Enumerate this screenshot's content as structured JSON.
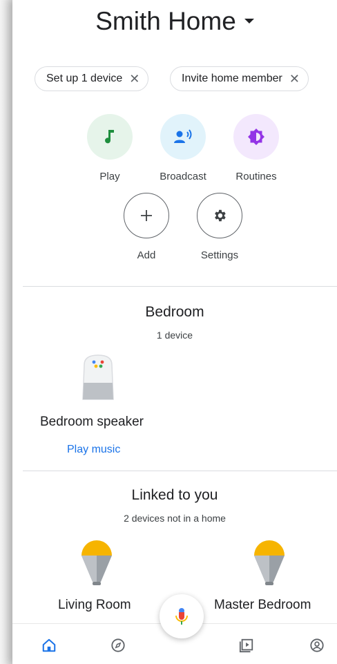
{
  "header": {
    "home_name": "Smith Home"
  },
  "chips": [
    {
      "label": "Set up 1 device"
    },
    {
      "label": "Invite home member"
    }
  ],
  "actions": [
    {
      "label": "Play",
      "icon": "music-note-icon",
      "bg": "#e6f4ea",
      "fg": "#1e8e3e"
    },
    {
      "label": "Broadcast",
      "icon": "broadcast-icon",
      "bg": "#e1f3fb",
      "fg": "#1a73e8"
    },
    {
      "label": "Routines",
      "icon": "routines-icon",
      "bg": "#f3e8fd",
      "fg": "#9334e6"
    },
    {
      "label": "Add",
      "icon": "plus-icon"
    },
    {
      "label": "Settings",
      "icon": "gear-icon"
    }
  ],
  "bedroom": {
    "title": "Bedroom",
    "subtitle": "1 device",
    "device_name": "Bedroom speaker",
    "action_label": "Play music"
  },
  "linked": {
    "title": "Linked to you",
    "subtitle": "2 devices not in a home",
    "devices": [
      {
        "name": "Living Room"
      },
      {
        "name": "Master Bedroom"
      }
    ]
  },
  "colors": {
    "link": "#1a73e8",
    "nav_active": "#1a73e8",
    "bulb_yellow": "#f6b400"
  },
  "bottom_nav": [
    "home-icon",
    "discover-icon",
    "media-icon",
    "account-icon"
  ]
}
